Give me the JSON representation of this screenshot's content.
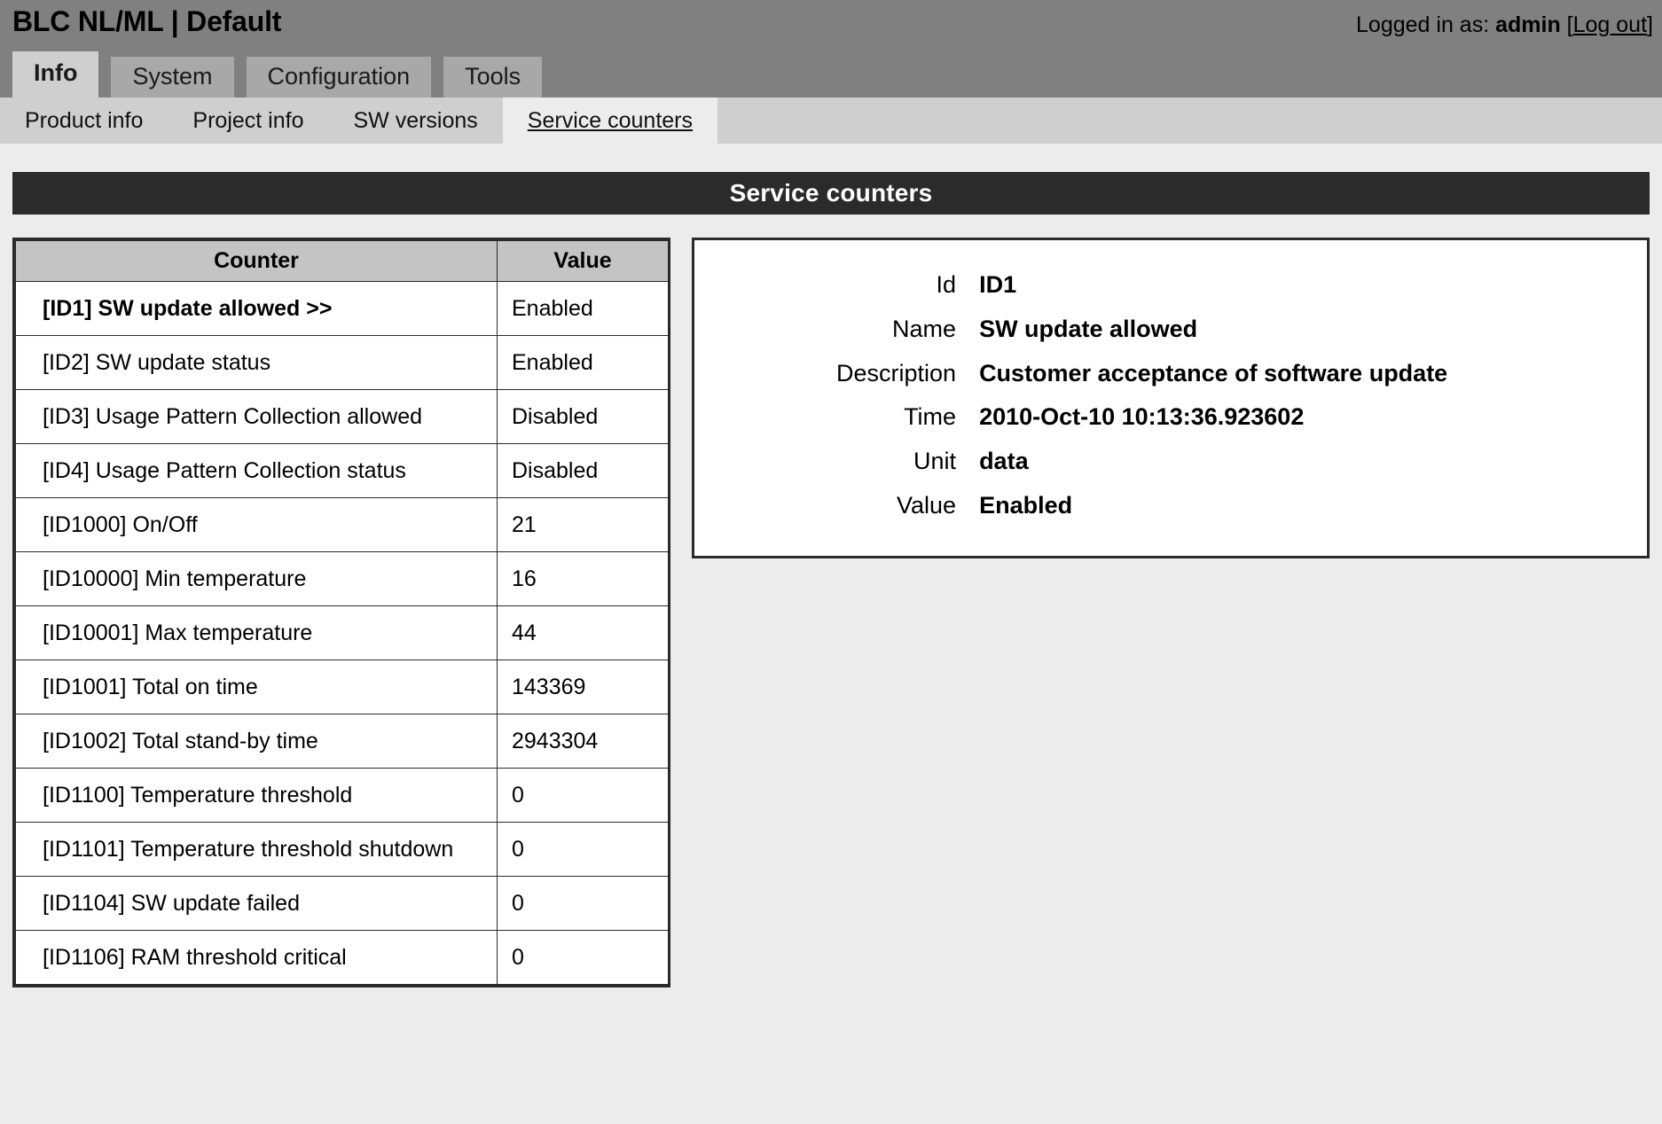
{
  "header": {
    "app_title": "BLC NL/ML  |  Default",
    "logged_in_prefix": "Logged in as:",
    "user": "admin",
    "logout_open": "[",
    "logout_label": "Log out",
    "logout_close": "]"
  },
  "main_tabs": [
    {
      "label": "Info",
      "active": true
    },
    {
      "label": "System",
      "active": false
    },
    {
      "label": "Configuration",
      "active": false
    },
    {
      "label": "Tools",
      "active": false
    }
  ],
  "sub_tabs": [
    {
      "label": "Product info",
      "active": false
    },
    {
      "label": "Project info",
      "active": false
    },
    {
      "label": "SW versions",
      "active": false
    },
    {
      "label": "Service counters",
      "active": true
    }
  ],
  "panel": {
    "title": "Service counters"
  },
  "counter_table": {
    "columns": [
      "Counter",
      "Value"
    ],
    "rows": [
      {
        "name": "[ID1] SW update allowed >>",
        "value": "Enabled",
        "selected": true
      },
      {
        "name": "[ID2] SW update status",
        "value": "Enabled",
        "selected": false
      },
      {
        "name": "[ID3] Usage Pattern Collection allowed",
        "value": "Disabled",
        "selected": false
      },
      {
        "name": "[ID4] Usage Pattern Collection status",
        "value": "Disabled",
        "selected": false
      },
      {
        "name": "[ID1000] On/Off",
        "value": "21",
        "selected": false
      },
      {
        "name": "[ID10000] Min temperature",
        "value": "16",
        "selected": false
      },
      {
        "name": "[ID10001] Max temperature",
        "value": "44",
        "selected": false
      },
      {
        "name": "[ID1001] Total on time",
        "value": "143369",
        "selected": false
      },
      {
        "name": "[ID1002] Total stand-by time",
        "value": "2943304",
        "selected": false
      },
      {
        "name": "[ID1100] Temperature threshold",
        "value": "0",
        "selected": false
      },
      {
        "name": "[ID1101] Temperature threshold shutdown",
        "value": "0",
        "selected": false
      },
      {
        "name": "[ID1104] SW update failed",
        "value": "0",
        "selected": false
      },
      {
        "name": "[ID1106] RAM threshold critical",
        "value": "0",
        "selected": false
      }
    ]
  },
  "detail": {
    "fields": [
      {
        "label": "Id",
        "value": "ID1"
      },
      {
        "label": "Name",
        "value": "SW update allowed"
      },
      {
        "label": "Description",
        "value": "Customer acceptance of software update"
      },
      {
        "label": "Time",
        "value": "2010-Oct-10 10:13:36.923602"
      },
      {
        "label": "Unit",
        "value": "data"
      },
      {
        "label": "Value",
        "value": "Enabled"
      }
    ]
  },
  "colors": {
    "topbar": "#808080",
    "tabbar": "#cfcfcf",
    "panel_header": "#2b2b2b",
    "page_bg": "#ececec",
    "table_header": "#c4c4c4",
    "border": "#2a2a2a"
  }
}
